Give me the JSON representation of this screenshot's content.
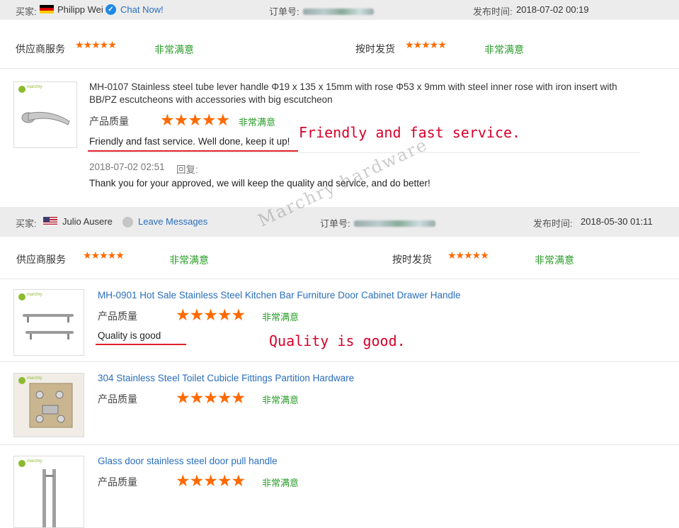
{
  "watermark": "Marchry hardware",
  "orders": [
    {
      "buyer_label": "买家:",
      "buyer_name": "Philipp Wei",
      "country_flag": "germany-flag-icon",
      "contact_link": "Chat Now!",
      "order_label": "订单号:",
      "time_label": "发布时间:",
      "time": "2018-07-02 00:19",
      "supplier_service_label": "供应商服务",
      "supplier_service_stars": "★★★★★",
      "supplier_service_verdict": "非常满意",
      "shipping_label": "按时发货",
      "shipping_stars": "★★★★★",
      "shipping_verdict": "非常满意",
      "products": [
        {
          "thumb_logo": "marchry",
          "title": "MH-0107 Stainless steel tube lever handle Φ19 x 135 x 15mm with rose Φ53 x 9mm with steel inner rose with iron insert with BB/PZ escutcheons with accessories with big escutcheon",
          "quality_label": "产品质量",
          "quality_stars": "★★★★★",
          "quality_verdict": "非常满意",
          "review": "Friendly and fast service. Well done, keep it up!",
          "annotation": "Friendly and fast service.",
          "reply_time": "2018-07-02 02:51",
          "reply_label": "回复:",
          "reply": "Thank you for your approved, we will keep the quality and service, and do better!"
        }
      ]
    },
    {
      "buyer_label": "买家:",
      "buyer_name": "Julio Ausere",
      "country_flag": "usa-flag-icon",
      "contact_link": "Leave Messages",
      "order_label": "订单号:",
      "time_label": "发布时间:",
      "time": "2018-05-30 01:11",
      "supplier_service_label": "供应商服务",
      "supplier_service_stars": "★★★★★",
      "supplier_service_verdict": "非常满意",
      "shipping_label": "按时发货",
      "shipping_stars": "★★★★★",
      "shipping_verdict": "非常满意",
      "products": [
        {
          "thumb_logo": "marchry",
          "title": "MH-0901 Hot Sale Stainless Steel Kitchen Bar Furniture Door Cabinet Drawer Handle",
          "quality_label": "产品质量",
          "quality_stars": "★★★★★",
          "quality_verdict": "非常满意",
          "review": "Quality is good",
          "annotation": "Quality is good."
        },
        {
          "thumb_logo": "marchry",
          "title": "304 Stainless Steel Toilet Cubicle Fittings Partition Hardware",
          "quality_label": "产品质量",
          "quality_stars": "★★★★★",
          "quality_verdict": "非常满意"
        },
        {
          "thumb_logo": "marchry",
          "title": "Glass door stainless steel door pull handle",
          "quality_label": "产品质量",
          "quality_stars": "★★★★★",
          "quality_verdict": "非常满意"
        }
      ]
    }
  ]
}
